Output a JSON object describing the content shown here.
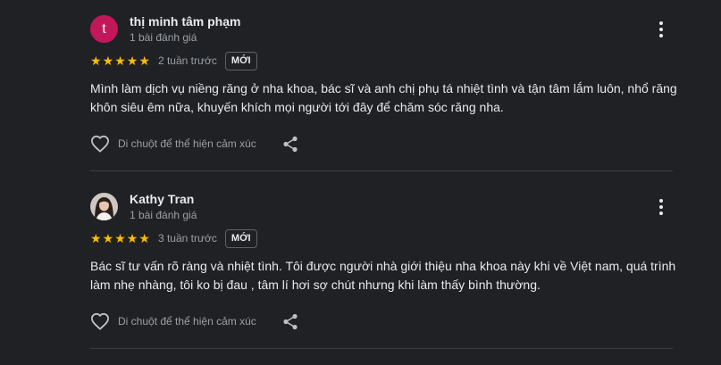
{
  "reviews": [
    {
      "avatar_letter": "t",
      "avatar_color": "#c2185b",
      "name": "thị minh tâm phạm",
      "review_count": "1 bài đánh giá",
      "rating": 5,
      "time": "2 tuần trước",
      "badge": "MỚI",
      "text": "Mình làm dịch vụ niềng răng ở nha khoa, bác sĩ và anh chị phụ tá nhiệt tình và tận tâm lắm luôn, nhổ răng khôn siêu êm nữa, khuyến khích mọi người tới đây để chăm sóc răng nha.",
      "like_label": "Di chuột để thể hiện cảm xúc",
      "like_icon": "heart-outline-icon",
      "share_icon": "share-icon",
      "more_icon": "more-vertical-icon"
    },
    {
      "avatar_letter": "",
      "avatar_color": "#3c2f2a",
      "name": "Kathy Tran",
      "review_count": "1 bài đánh giá",
      "rating": 5,
      "time": "3 tuần trước",
      "badge": "MỚI",
      "text": "Bác sĩ tư vấn rõ ràng và nhiệt tình. Tôi được người nhà giới thiệu nha khoa này khi về Việt nam, quá trình làm nhẹ nhàng, tôi ko bị đau , tâm lí hơi sợ chút nhưng khi làm thấy bình thường.",
      "like_label": "Di chuột để thể hiện cảm xúc",
      "like_icon": "heart-outline-icon",
      "share_icon": "share-icon",
      "more_icon": "more-vertical-icon"
    }
  ],
  "colors": {
    "background": "#202124",
    "star": "#fbbc04",
    "text_primary": "#e8eaed",
    "text_secondary": "#9aa0a6",
    "divider": "#3c4043"
  }
}
